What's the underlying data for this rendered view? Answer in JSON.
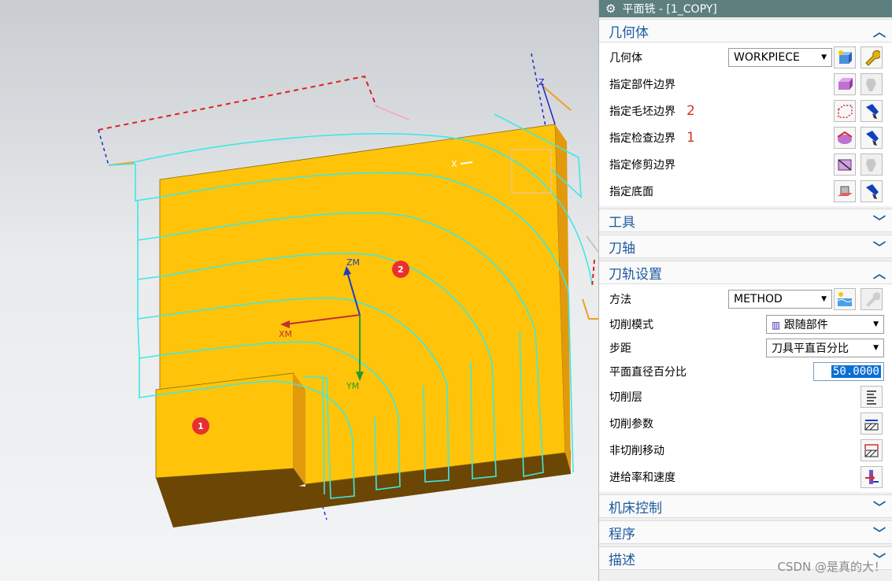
{
  "dialog": {
    "title": "平面铣 - [1_COPY]",
    "title_icon": "gear-icon"
  },
  "sections": {
    "geometry": {
      "title": "几何体",
      "expanded": true,
      "geometry_label": "几何体",
      "geometry_value": "WORKPIECE",
      "part_boundary_label": "指定部件边界",
      "blank_boundary_label": "指定毛坯边界",
      "blank_boundary_note": "2",
      "check_boundary_label": "指定检查边界",
      "check_boundary_note": "1",
      "trim_boundary_label": "指定修剪边界",
      "floor_label": "指定底面"
    },
    "tool": {
      "title": "工具",
      "expanded": false
    },
    "tool_axis": {
      "title": "刀轴",
      "expanded": false
    },
    "path_settings": {
      "title": "刀轨设置",
      "expanded": true,
      "method_label": "方法",
      "method_value": "METHOD",
      "cut_pattern_label": "切削模式",
      "cut_pattern_value": "跟随部件",
      "stepover_label": "步距",
      "stepover_value": "刀具平直百分比",
      "flat_diameter_label": "平面直径百分比",
      "flat_diameter_value": "50.0000",
      "cut_levels_label": "切削层",
      "cutting_params_label": "切削参数",
      "non_cutting_label": "非切削移动",
      "feeds_speeds_label": "进给率和速度"
    },
    "machine_control": {
      "title": "机床控制",
      "expanded": false
    },
    "program": {
      "title": "程序",
      "expanded": false
    },
    "description": {
      "title": "描述",
      "expanded": false
    }
  },
  "viewport": {
    "axis_labels": {
      "zm": "ZM",
      "xm": "XM",
      "ym": "YM",
      "x": "X",
      "z": "Z"
    },
    "markers": {
      "one": "1",
      "two": "2"
    },
    "colors": {
      "part": "#ffc409",
      "part_side": "#e29a0c",
      "part_bottom": "#6b4605",
      "toolpath": "#3ee8e4",
      "blank": "#e02020"
    }
  },
  "watermark": "CSDN @是真的大！"
}
